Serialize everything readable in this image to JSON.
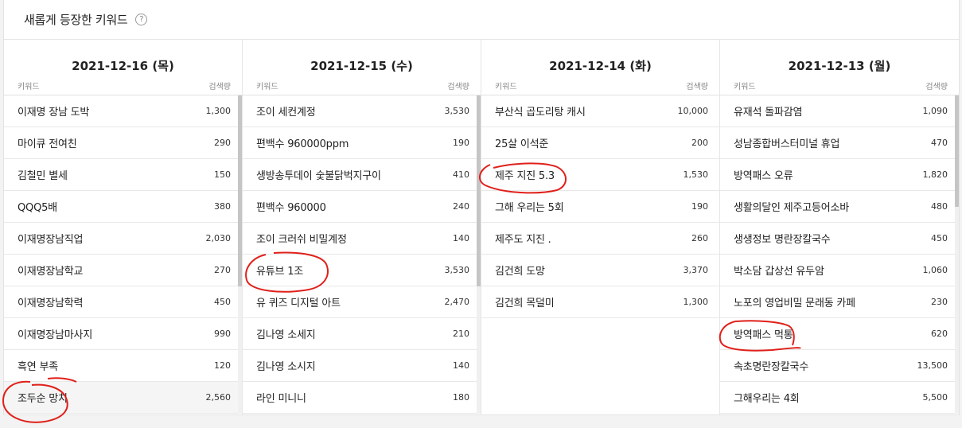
{
  "header": {
    "title": "새롭게 등장한 키워드",
    "help_icon": "?"
  },
  "columns": [
    {
      "date": "2021-12-16 (목)",
      "col_keyword": "키워드",
      "col_volume": "검색량",
      "rows": [
        {
          "keyword": "이재명 장남 도박",
          "volume": "1,300"
        },
        {
          "keyword": "마이큐 전여친",
          "volume": "290"
        },
        {
          "keyword": "김철민 별세",
          "volume": "150"
        },
        {
          "keyword": "QQQ5배",
          "volume": "380"
        },
        {
          "keyword": "이재명장남직업",
          "volume": "2,030"
        },
        {
          "keyword": "이재명장남학교",
          "volume": "270"
        },
        {
          "keyword": "이재명장남학력",
          "volume": "450"
        },
        {
          "keyword": "이재명장남마사지",
          "volume": "990"
        },
        {
          "keyword": "흑연 부족",
          "volume": "120"
        },
        {
          "keyword": "조두순 망치",
          "volume": "2,560"
        }
      ]
    },
    {
      "date": "2021-12-15 (수)",
      "col_keyword": "키워드",
      "col_volume": "검색량",
      "rows": [
        {
          "keyword": "조이 세컨계정",
          "volume": "3,530"
        },
        {
          "keyword": "편백수 960000ppm",
          "volume": "190"
        },
        {
          "keyword": "생방송투데이 숯불닭벅지구이",
          "volume": "410"
        },
        {
          "keyword": "편백수 960000",
          "volume": "240"
        },
        {
          "keyword": "조이 크러쉬 비밀계정",
          "volume": "140"
        },
        {
          "keyword": "유튜브 1조",
          "volume": "3,530"
        },
        {
          "keyword": "유 퀴즈 디지털 아트",
          "volume": "2,470"
        },
        {
          "keyword": "김나영 소세지",
          "volume": "210"
        },
        {
          "keyword": "김나영 소시지",
          "volume": "140"
        },
        {
          "keyword": "라인 미니니",
          "volume": "180"
        }
      ]
    },
    {
      "date": "2021-12-14 (화)",
      "col_keyword": "키워드",
      "col_volume": "검색량",
      "rows": [
        {
          "keyword": "부산식 곱도리탕 캐시",
          "volume": "10,000"
        },
        {
          "keyword": "25살 이석준",
          "volume": "200"
        },
        {
          "keyword": "제주 지진 5.3",
          "volume": "1,530"
        },
        {
          "keyword": "그해 우리는 5회",
          "volume": "190"
        },
        {
          "keyword": "제주도 지진 .",
          "volume": "260"
        },
        {
          "keyword": "김건희 도망",
          "volume": "3,370"
        },
        {
          "keyword": "김건희 목덜미",
          "volume": "1,300"
        }
      ]
    },
    {
      "date": "2021-12-13 (월)",
      "col_keyword": "키워드",
      "col_volume": "검색량",
      "rows": [
        {
          "keyword": "유재석 돌파감염",
          "volume": "1,090"
        },
        {
          "keyword": "성남종합버스터미널 휴업",
          "volume": "470"
        },
        {
          "keyword": "방역패스 오류",
          "volume": "1,820"
        },
        {
          "keyword": "생활의달인 제주고등어소바",
          "volume": "480"
        },
        {
          "keyword": "생생정보 명란장칼국수",
          "volume": "450"
        },
        {
          "keyword": "박소담 갑상선 유두암",
          "volume": "1,060"
        },
        {
          "keyword": "노포의 영업비밀 문래동 카페",
          "volume": "230"
        },
        {
          "keyword": "방역패스 먹통",
          "volume": "620"
        },
        {
          "keyword": "속초명란장칼국수",
          "volume": "13,500"
        },
        {
          "keyword": "그해우리는 4회",
          "volume": "5,500"
        }
      ]
    }
  ],
  "colors": {
    "annotation": "#e0201a",
    "scroll_thumb": "#c5c5c5"
  }
}
